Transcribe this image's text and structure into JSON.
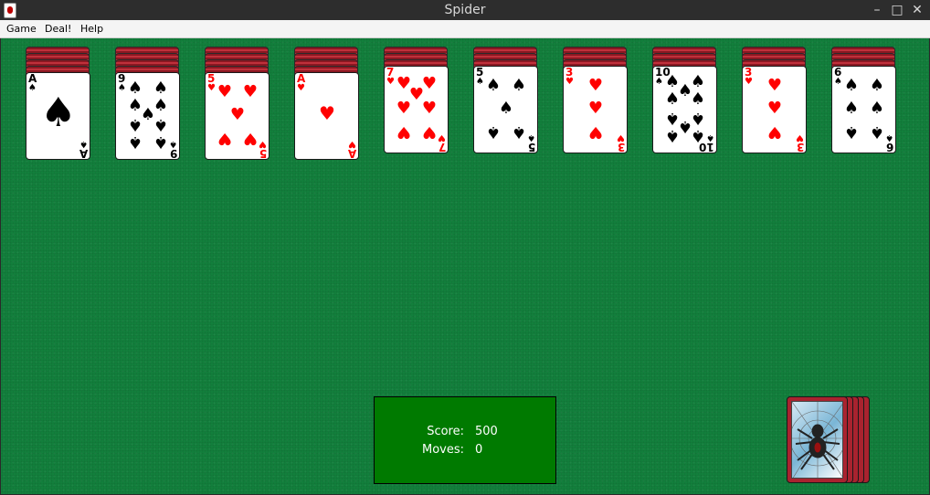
{
  "window": {
    "title": "Spider",
    "minimize_label": "–",
    "maximize_label": "□",
    "close_label": "✕"
  },
  "menu": {
    "game": "Game",
    "deal": "Deal!",
    "help": "Help"
  },
  "colors": {
    "felt": "#127f3c",
    "score_box": "#007a00",
    "card_back": "#a9232f",
    "red_suit": "#ff0000"
  },
  "tableau": [
    {
      "backs": 4,
      "card": {
        "rank": "A",
        "suit": "♠",
        "color": "black"
      }
    },
    {
      "backs": 4,
      "card": {
        "rank": "9",
        "suit": "♠",
        "color": "black"
      }
    },
    {
      "backs": 4,
      "card": {
        "rank": "5",
        "suit": "♥",
        "color": "red"
      }
    },
    {
      "backs": 4,
      "card": {
        "rank": "A",
        "suit": "♥",
        "color": "red"
      }
    },
    {
      "backs": 3,
      "card": {
        "rank": "7",
        "suit": "♥",
        "color": "red"
      }
    },
    {
      "backs": 3,
      "card": {
        "rank": "5",
        "suit": "♠",
        "color": "black"
      }
    },
    {
      "backs": 3,
      "card": {
        "rank": "3",
        "suit": "♥",
        "color": "red"
      }
    },
    {
      "backs": 3,
      "card": {
        "rank": "10",
        "suit": "♠",
        "color": "black"
      }
    },
    {
      "backs": 3,
      "card": {
        "rank": "3",
        "suit": "♥",
        "color": "red"
      }
    },
    {
      "backs": 3,
      "card": {
        "rank": "6",
        "suit": "♠",
        "color": "black"
      }
    }
  ],
  "score": {
    "score_label": "Score:",
    "score_value": "500",
    "moves_label": "Moves:",
    "moves_value": "0"
  },
  "stock": {
    "piles_remaining": 5,
    "icon": "spider-icon"
  }
}
